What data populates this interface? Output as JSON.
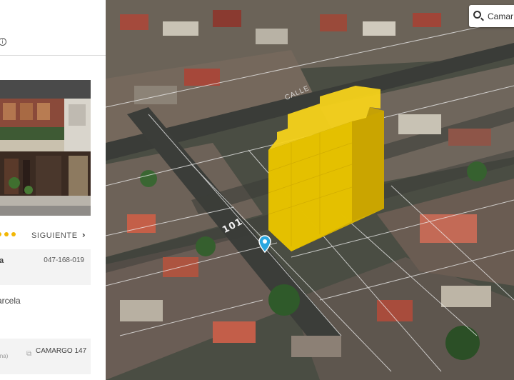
{
  "panel": {
    "info_icon": "info-icon",
    "carousel": {
      "dot_color": "#f2b705",
      "dot_count": 3,
      "next_label": "SIGUIENTE",
      "next_icon": "chevron-right-icon"
    },
    "rows": [
      {
        "label": "a",
        "value": "047-168-019"
      }
    ],
    "parcela_text": "arcela",
    "address_row": {
      "left_text": "ina)",
      "icon": "copy-icon",
      "value": "CAMARGO 147"
    }
  },
  "map": {
    "search": {
      "icon": "search-icon",
      "value": "Camar"
    },
    "street_labels": [
      "101",
      "CALLE"
    ],
    "highlight_color": "#f2c700",
    "pin_color": "#2aa7e0",
    "pin_icon": "location-pin-icon"
  }
}
